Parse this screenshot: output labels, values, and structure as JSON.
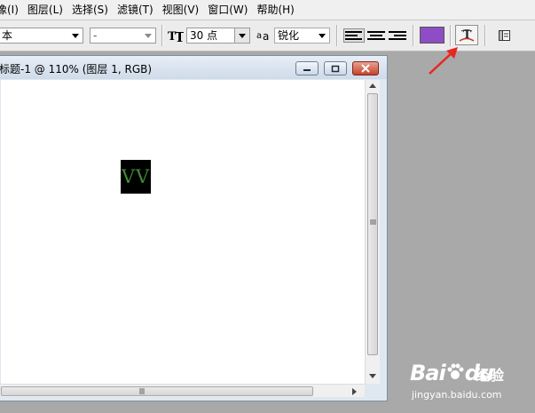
{
  "menubar": {
    "items": [
      "像(I)",
      "图层(L)",
      "选择(S)",
      "滤镜(T)",
      "视图(V)",
      "窗口(W)",
      "帮助(H)"
    ]
  },
  "options": {
    "font_family_value": "本",
    "font_style_value": "-",
    "font_size_value": "30 点",
    "antialias_value": "锐化",
    "text_color": "#8e4dc6"
  },
  "document": {
    "title": "标题-1 @ 110% (图层 1, RGB)",
    "text_layer_content": "VV",
    "text_color": "#3e8b2e"
  },
  "annotation": {
    "arrow_color": "#e8271f"
  },
  "watermark": {
    "brand": "Bai",
    "brand_tail": "du",
    "product": "经验",
    "url": "jingyan.baidu.com"
  }
}
